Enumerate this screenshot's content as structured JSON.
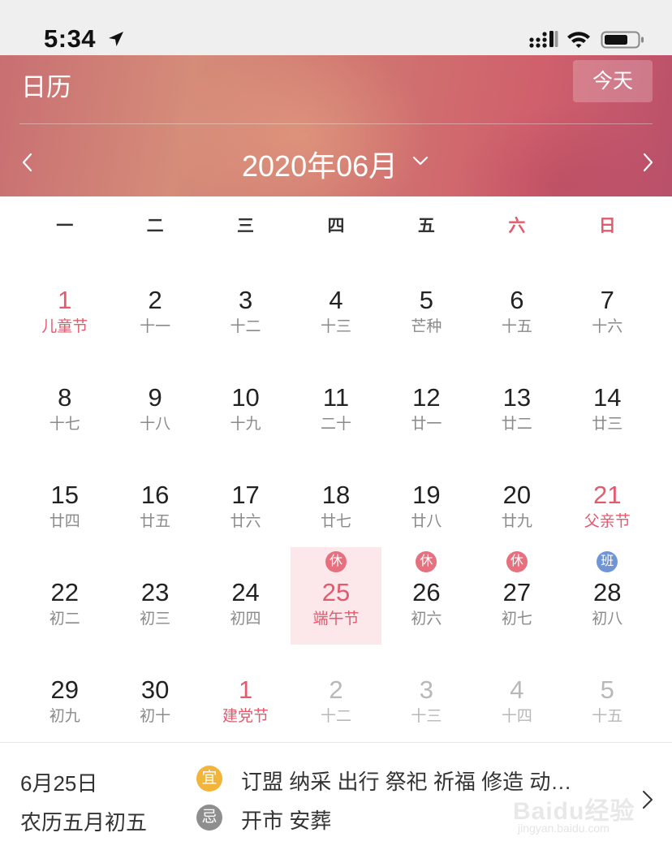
{
  "status_bar": {
    "time": "5:34"
  },
  "header": {
    "title": "日历",
    "today_label": "今天",
    "month_label": "2020年06月"
  },
  "weekdays": [
    "一",
    "二",
    "三",
    "四",
    "五",
    "六",
    "日"
  ],
  "days": [
    {
      "num": "1",
      "sub": "儿童节",
      "red": true
    },
    {
      "num": "2",
      "sub": "十一"
    },
    {
      "num": "3",
      "sub": "十二"
    },
    {
      "num": "4",
      "sub": "十三"
    },
    {
      "num": "5",
      "sub": "芒种"
    },
    {
      "num": "6",
      "sub": "十五"
    },
    {
      "num": "7",
      "sub": "十六"
    },
    {
      "num": "8",
      "sub": "十七"
    },
    {
      "num": "9",
      "sub": "十八"
    },
    {
      "num": "10",
      "sub": "十九"
    },
    {
      "num": "11",
      "sub": "二十"
    },
    {
      "num": "12",
      "sub": "廿一"
    },
    {
      "num": "13",
      "sub": "廿二"
    },
    {
      "num": "14",
      "sub": "廿三"
    },
    {
      "num": "15",
      "sub": "廿四"
    },
    {
      "num": "16",
      "sub": "廿五"
    },
    {
      "num": "17",
      "sub": "廿六"
    },
    {
      "num": "18",
      "sub": "廿七"
    },
    {
      "num": "19",
      "sub": "廿八"
    },
    {
      "num": "20",
      "sub": "廿九"
    },
    {
      "num": "21",
      "sub": "父亲节",
      "red": true
    },
    {
      "num": "22",
      "sub": "初二"
    },
    {
      "num": "23",
      "sub": "初三"
    },
    {
      "num": "24",
      "sub": "初四"
    },
    {
      "num": "25",
      "sub": "端午节",
      "red": true,
      "selected": true,
      "badge": "休",
      "badge_type": "rest"
    },
    {
      "num": "26",
      "sub": "初六",
      "badge": "休",
      "badge_type": "rest"
    },
    {
      "num": "27",
      "sub": "初七",
      "badge": "休",
      "badge_type": "rest"
    },
    {
      "num": "28",
      "sub": "初八",
      "badge": "班",
      "badge_type": "work"
    },
    {
      "num": "29",
      "sub": "初九"
    },
    {
      "num": "30",
      "sub": "初十"
    },
    {
      "num": "1",
      "sub": "建党节",
      "red": true
    },
    {
      "num": "2",
      "sub": "十二",
      "other": true
    },
    {
      "num": "3",
      "sub": "十三",
      "other": true
    },
    {
      "num": "4",
      "sub": "十四",
      "other": true
    },
    {
      "num": "5",
      "sub": "十五",
      "other": true
    }
  ],
  "detail": {
    "date": "6月25日",
    "lunar": "农历五月初五",
    "yi_label": "宜",
    "yi_text": "订盟 纳采 出行 祭祀 祈福 修造 动…",
    "ji_label": "忌",
    "ji_text": "开市 安葬"
  },
  "watermark": {
    "main": "Baidu经验",
    "sub": "jingyan.baidu.com"
  },
  "colors": {
    "accent_red": "#e35a6c",
    "selected_bg": "#fce7ea",
    "rest_badge": "#e6707e",
    "work_badge": "#6f95d6",
    "yi_badge": "#f2b43a",
    "ji_badge": "#8e8e8e"
  }
}
